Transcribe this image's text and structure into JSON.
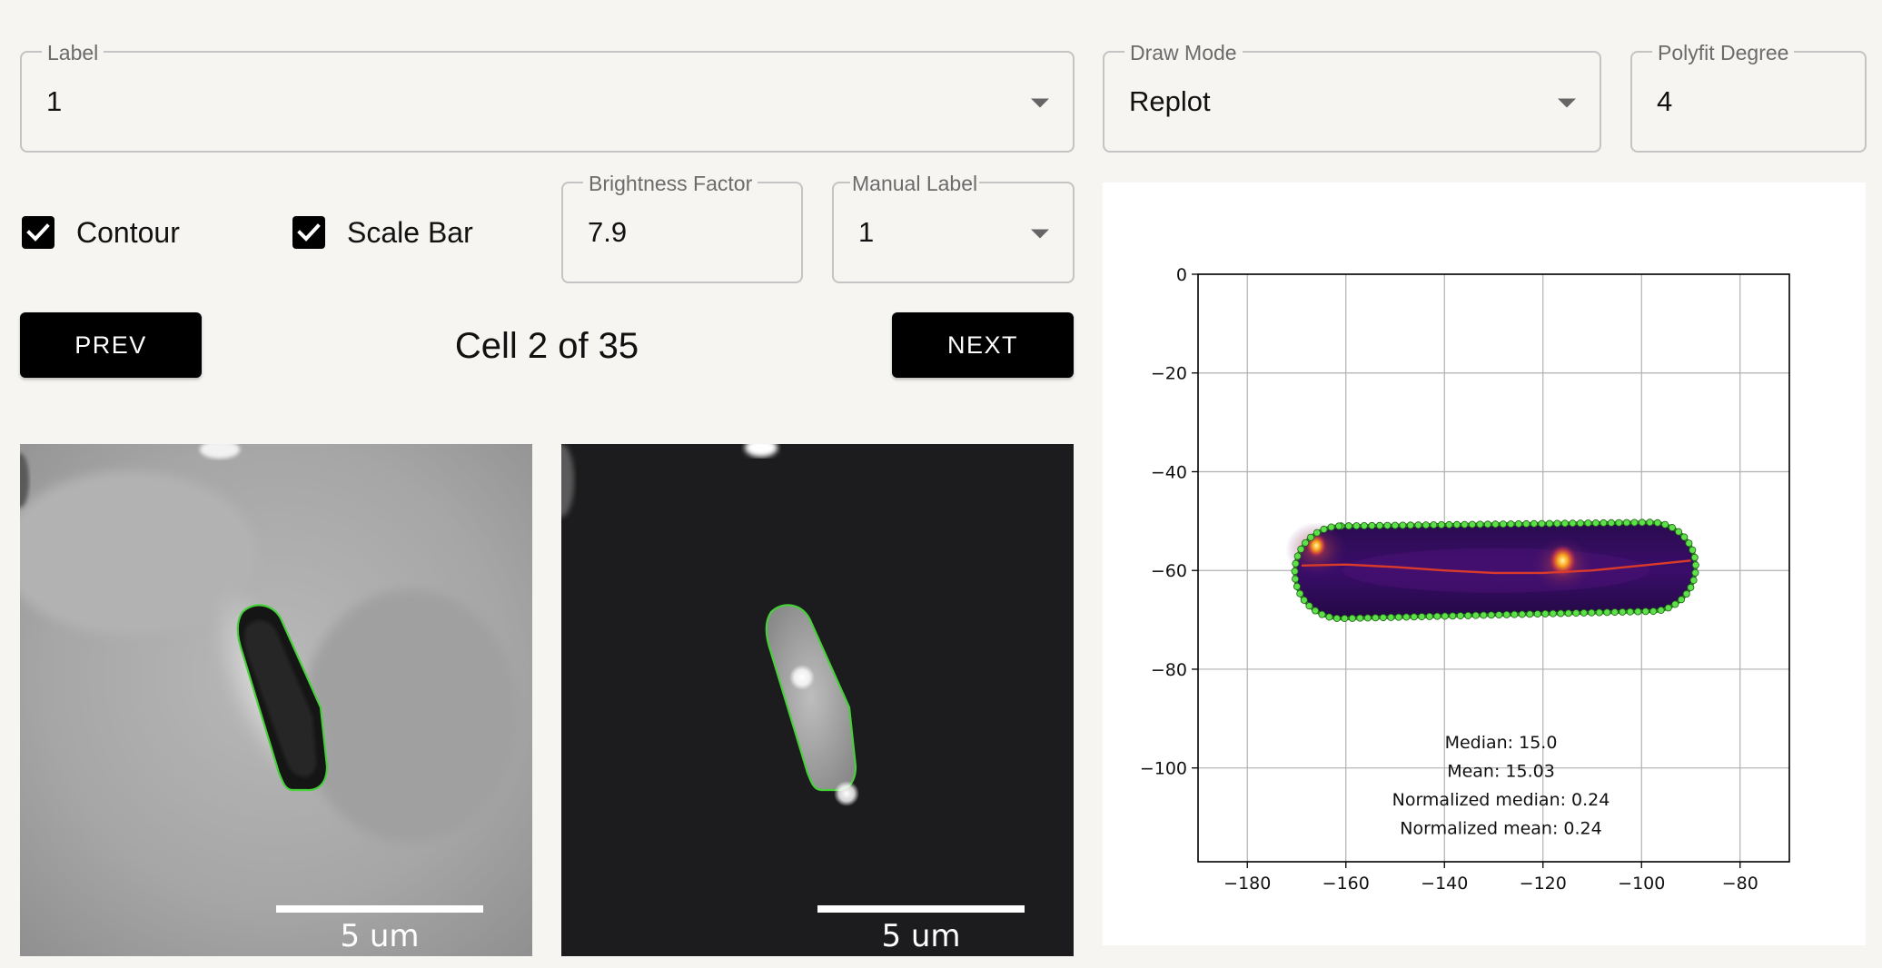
{
  "label_field": {
    "legend": "Label",
    "value": "1"
  },
  "draw_mode_field": {
    "legend": "Draw Mode",
    "value": "Replot"
  },
  "polyfit_field": {
    "legend": "Polyfit Degree",
    "value": "4"
  },
  "brightness_field": {
    "legend": "Brightness Factor",
    "value": "7.9"
  },
  "manual_label_field": {
    "legend": "Manual Label",
    "value": "1"
  },
  "contour_checkbox": {
    "label": "Contour",
    "checked": true
  },
  "scalebar_checkbox": {
    "label": "Scale Bar",
    "checked": true
  },
  "nav": {
    "prev_label": "PREV",
    "next_label": "NEXT",
    "cell_counter": "Cell 2 of 35"
  },
  "phase_image": {
    "scale_bar_text": "5 um",
    "contour_color": "#46d13a"
  },
  "fluor_image": {
    "scale_bar_text": "5 um",
    "contour_color": "#46d13a"
  },
  "chart_data": {
    "type": "scatter",
    "title": "",
    "xlabel": "",
    "ylabel": "",
    "xlim": [
      -190,
      -70
    ],
    "ylim": [
      0,
      -119
    ],
    "x_ticks": [
      -180,
      -160,
      -140,
      -120,
      -100,
      -80
    ],
    "y_ticks": [
      0,
      -20,
      -40,
      -60,
      -80,
      -100
    ],
    "x_tick_labels": [
      "−180",
      "−160",
      "−140",
      "−120",
      "−100",
      "−80"
    ],
    "y_tick_labels": [
      "0",
      "−20",
      "−40",
      "−60",
      "−80",
      "−100"
    ],
    "grid": true,
    "annotations": [
      "Median: 15.0",
      "Mean: 15.03",
      "Normalized median: 0.24",
      "Normalized mean: 0.24"
    ],
    "series": [
      {
        "kind": "polyfit-line",
        "color": "#d93a2a",
        "points": [
          [
            -169,
            -59
          ],
          [
            -160,
            -58.8
          ],
          [
            -150,
            -59.3
          ],
          [
            -140,
            -60
          ],
          [
            -130,
            -60.5
          ],
          [
            -120,
            -60.5
          ],
          [
            -110,
            -60
          ],
          [
            -100,
            -59
          ],
          [
            -90,
            -58
          ]
        ]
      }
    ],
    "cell_region": {
      "x_range": [
        -170,
        -89
      ],
      "y_range": [
        -51,
        -69
      ],
      "colormap": "inferno",
      "bright_spots": [
        [
          -116,
          -58
        ],
        [
          -166,
          -55
        ]
      ],
      "contour_color": "#5ee04a"
    }
  }
}
